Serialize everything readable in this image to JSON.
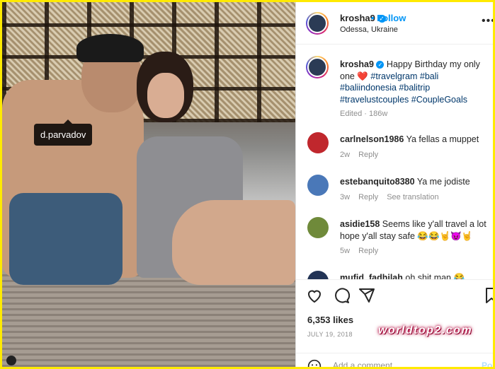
{
  "post": {
    "photo_tag": "d.parvadov"
  },
  "header": {
    "username": "krosha9",
    "follow_label": "Follow",
    "location": "Odessa, Ukraine",
    "more_icon": "more-icon"
  },
  "caption": {
    "username": "krosha9",
    "text_start": "Happy Birthday my only one",
    "heart": "❤️",
    "hashtags": [
      "#travelgram",
      "#bali",
      "#baliindonesia",
      "#balitrip",
      "#travelustcouples",
      "#CoupleGoals"
    ],
    "meta": "Edited · 186w"
  },
  "comments": [
    {
      "username": "carlnelson1986",
      "text": "Ya fellas a muppet",
      "time": "2w",
      "reply": "Reply",
      "extra": "",
      "avatar_color": "#c0272d"
    },
    {
      "username": "estebanquito8380",
      "text": "Ya me jodiste",
      "time": "3w",
      "reply": "Reply",
      "extra": "See translation",
      "avatar_color": "#4a78b8"
    },
    {
      "username": "asidie158",
      "text": "Seems like y'all travel a lot hope y'all stay safe 😂😂🤘😈🤘",
      "time": "5w",
      "reply": "Reply",
      "extra": "",
      "avatar_color": "#6f8a3a"
    },
    {
      "username": "mufid_fadhilah",
      "text": "oh shit man 😂",
      "time": "",
      "reply": "",
      "extra": "",
      "avatar_color": "#223355"
    }
  ],
  "actions": {
    "like_icon": "heart-icon",
    "comment_icon": "comment-icon",
    "share_icon": "share-icon",
    "save_icon": "bookmark-icon"
  },
  "likes": "6,353 likes",
  "date": "JULY 19, 2018",
  "watermark": "worldtop2.com",
  "add_comment": {
    "placeholder": "Add a comment...",
    "post_label": "Pos"
  },
  "colors": {
    "frame": "#ffea00",
    "accent": "#0095f6",
    "hashtag": "#00376b",
    "secondary_text": "#8e8e8e"
  }
}
